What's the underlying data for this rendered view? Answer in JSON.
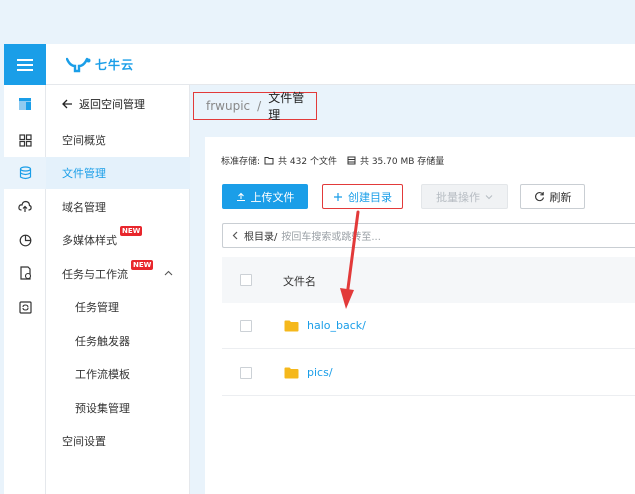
{
  "header": {
    "logo_text": "七牛云",
    "brand_color": "#1a9ee8"
  },
  "iconbar": {
    "items": [
      "storage-logo-icon",
      "dashboard-grid-icon",
      "database-icon",
      "cloud-upload-icon",
      "pie-chart-icon",
      "file-check-icon",
      "refresh-box-icon"
    ]
  },
  "sidebar": {
    "back_label": "返回空间管理",
    "items": [
      {
        "label": "空间概览"
      },
      {
        "label": "文件管理"
      },
      {
        "label": "域名管理"
      },
      {
        "label": "多媒体样式",
        "badge": "NEW"
      },
      {
        "label": "任务与工作流",
        "badge": "NEW"
      },
      {
        "label": "任务管理"
      },
      {
        "label": "任务触发器"
      },
      {
        "label": "工作流模板"
      },
      {
        "label": "预设集管理"
      },
      {
        "label": "空间设置"
      }
    ]
  },
  "breadcrumb": {
    "root": "frwupic",
    "separator": "/",
    "current": "文件管理"
  },
  "stats": {
    "storage_type": "标准存储:",
    "file_count": "共 432 个文件",
    "storage_size": "共 35.70 MB 存储量"
  },
  "toolbar": {
    "upload": "上传文件",
    "create_dir": "创建目录",
    "batch": "批量操作",
    "refresh": "刷新"
  },
  "search": {
    "prefix": "根目录/",
    "placeholder": "按回车搜索或跳转至..."
  },
  "table": {
    "header_name": "文件名",
    "rows": [
      {
        "name": "halo_back/"
      },
      {
        "name": "pics/"
      }
    ]
  },
  "annotation_color": "#e23a3a"
}
